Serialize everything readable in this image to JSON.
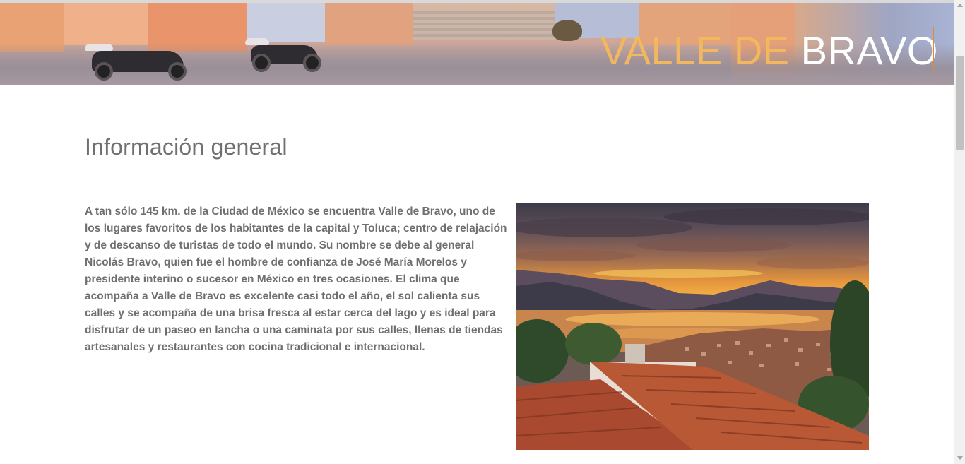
{
  "hero": {
    "title_part1": "VALLE DE",
    "title_part2": "BRAVO",
    "accent_color": "#f3b85e"
  },
  "main": {
    "section_title": "Información general",
    "paragraph": "A tan sólo 145 km. de la Ciudad de México se encuentra Valle de Bravo, uno de los lugares favoritos de los habitantes de la capital y Toluca; centro de relajación y de descanso de turistas de todo el mundo. Su nombre se debe al general Nicolás Bravo, quien fue el hombre de confianza de José María Morelos y presidente interino o sucesor en México en tres ocasiones. El clima que acompaña a Valle de Bravo es excelente casi todo el año, el sol calienta sus calles y se acompaña de una brisa fresca al estar cerca del lago y es ideal para disfrutar de un paseo en lancha o una caminata por sus calles, llenas de tiendas artesanales y restaurantes con cocina tradicional e internacional.",
    "text_color": "#6f6f6f"
  },
  "icons": {
    "scroll_up": "chevron-up-icon",
    "scroll_down": "chevron-down-icon"
  }
}
